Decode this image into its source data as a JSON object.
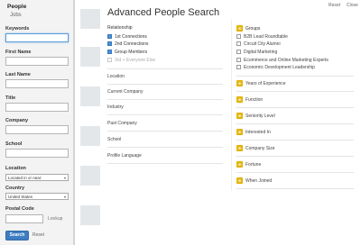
{
  "sidebar": {
    "tabs": [
      "People",
      "Jobs"
    ],
    "fields": {
      "keywords": "Keywords",
      "first_name": "First Name",
      "last_name": "Last Name",
      "title": "Title",
      "company": "Company",
      "school": "School",
      "location": "Location",
      "country": "Country",
      "postal_code": "Postal Code"
    },
    "location_value": "Located in or near:",
    "country_value": "United States",
    "lookup": "Lookup",
    "search_button": "Search",
    "reset": "Reset"
  },
  "header": {
    "reset": "Reset",
    "close": "Close"
  },
  "main": {
    "title": "Advanced People Search",
    "relationship": {
      "label": "Relationship",
      "options": [
        {
          "label": "1st Connections",
          "checked": true
        },
        {
          "label": "2nd Connections",
          "checked": true
        },
        {
          "label": "Group Members",
          "checked": true
        },
        {
          "label": "3rd + Everyone Else",
          "checked": false
        }
      ]
    },
    "facets": [
      "Location",
      "Current Company",
      "Industry",
      "Past Company",
      "School",
      "Profile Language"
    ],
    "groups": {
      "label": "Groups",
      "items": [
        "B2B Lead Roundtable",
        "Circuit City Alumni",
        "Digital Marketing",
        "Ecommerce and Online Marketing Experts",
        "Economic Development Leadership"
      ]
    },
    "upgrade_facets": [
      "Years of Experience",
      "Function",
      "Seniority Level",
      "Interested In",
      "Company Size",
      "Fortune",
      "When Joined"
    ],
    "badge": "in"
  },
  "colors": {
    "accent": "#3f7dc2",
    "badge": "#e2b100",
    "checkbox": "#4a90d9"
  }
}
